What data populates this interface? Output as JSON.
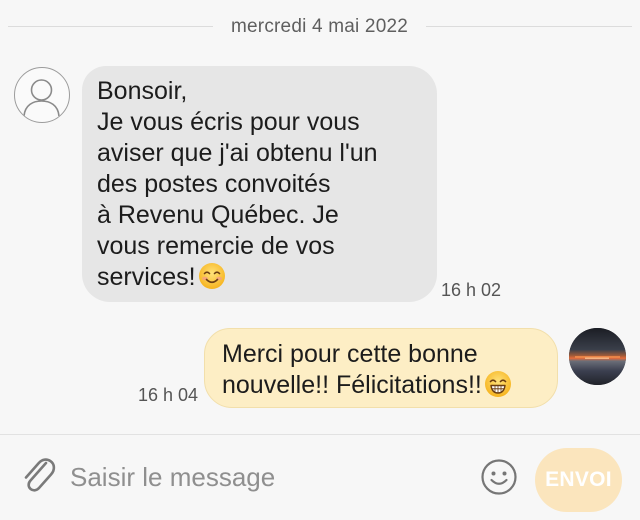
{
  "conversation": {
    "date_separator": "mercredi 4 mai 2022"
  },
  "messages": [
    {
      "direction": "incoming",
      "text": "Bonsoir,\nJe vous écris pour vous\naviser que j'ai obtenu l'un\ndes postes convoités\nà Revenu Québec. Je\nvous remercie de vos\nservices!",
      "emoji": "smiling-face-icon",
      "time": "16 h 02"
    },
    {
      "direction": "outgoing",
      "text": "Merci pour cette bonne\nnouvelle!! Félicitations!!",
      "emoji": "grinning-face-icon",
      "time": "16 h 04"
    }
  ],
  "composer": {
    "placeholder": "Saisir le message",
    "send_label": "ENVOI",
    "attach_icon": "paperclip-icon",
    "emoji_icon": "emoji-picker-icon"
  },
  "colors": {
    "incoming_bubble": "#e6e6e6",
    "outgoing_bubble": "#fdeec5",
    "send_button": "#fbe5bd",
    "background": "#f7f7f7"
  }
}
